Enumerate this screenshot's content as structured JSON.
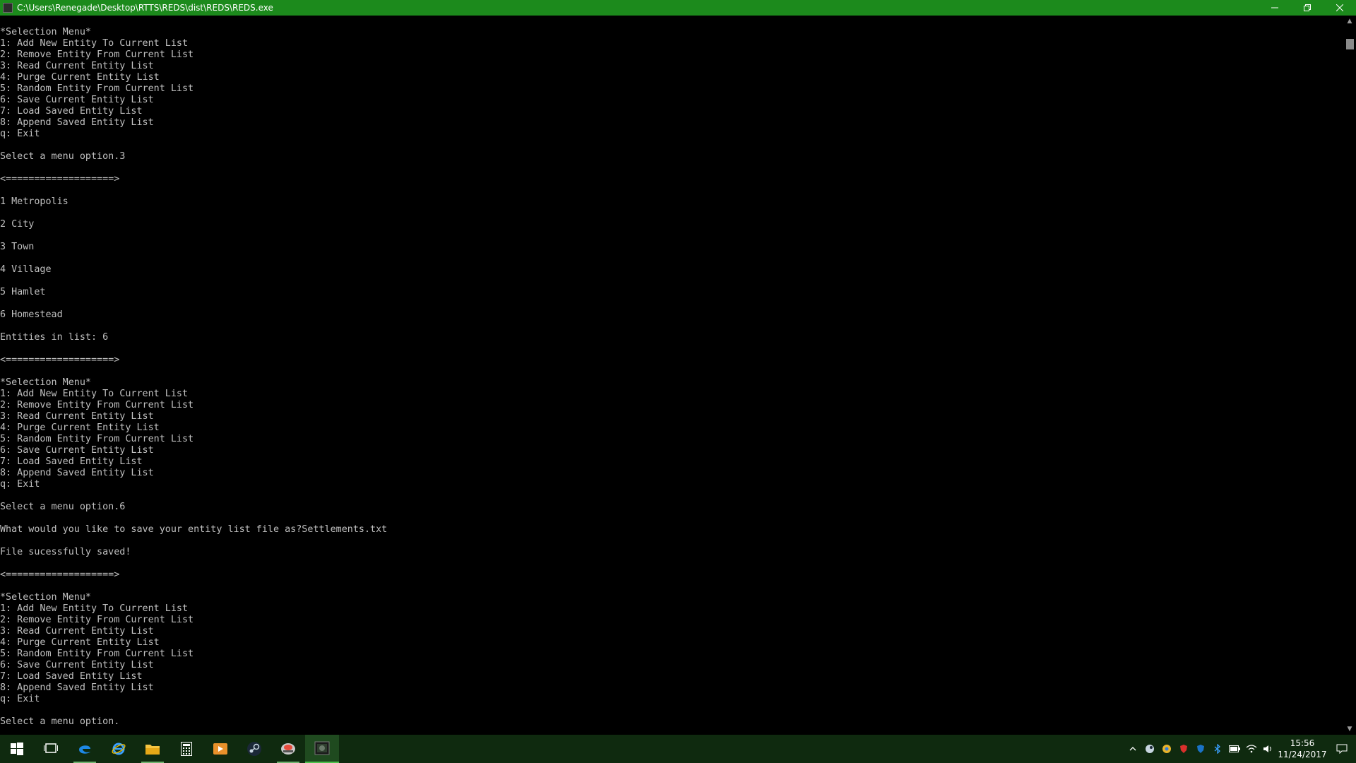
{
  "window": {
    "title": "C:\\Users\\Renegade\\Desktop\\RTTS\\REDS\\dist\\REDS\\REDS.exe",
    "controls": {
      "minimize": "—",
      "restore": "❐",
      "close": "✕"
    }
  },
  "console": {
    "lines": [
      "*Selection Menu*",
      "1: Add New Entity To Current List",
      "2: Remove Entity From Current List",
      "3: Read Current Entity List",
      "4: Purge Current Entity List",
      "5: Random Entity From Current List",
      "6: Save Current Entity List",
      "7: Load Saved Entity List",
      "8: Append Saved Entity List",
      "q: Exit",
      "",
      "Select a menu option.3",
      "",
      "<===================>",
      "",
      "1 Metropolis",
      "",
      "2 City",
      "",
      "3 Town",
      "",
      "4 Village",
      "",
      "5 Hamlet",
      "",
      "6 Homestead",
      "",
      "Entities in list: 6",
      "",
      "<===================>",
      "",
      "*Selection Menu*",
      "1: Add New Entity To Current List",
      "2: Remove Entity From Current List",
      "3: Read Current Entity List",
      "4: Purge Current Entity List",
      "5: Random Entity From Current List",
      "6: Save Current Entity List",
      "7: Load Saved Entity List",
      "8: Append Saved Entity List",
      "q: Exit",
      "",
      "Select a menu option.6",
      "",
      "What would you like to save your entity list file as?Settlements.txt",
      "",
      "File sucessfully saved!",
      "",
      "<===================>",
      "",
      "*Selection Menu*",
      "1: Add New Entity To Current List",
      "2: Remove Entity From Current List",
      "3: Read Current Entity List",
      "4: Purge Current Entity List",
      "5: Random Entity From Current List",
      "6: Save Current Entity List",
      "7: Load Saved Entity List",
      "8: Append Saved Entity List",
      "q: Exit",
      "",
      "Select a menu option."
    ]
  },
  "taskbar": {
    "apps": [
      {
        "name": "start-icon",
        "active": false
      },
      {
        "name": "task-view-icon",
        "active": false
      },
      {
        "name": "edge-icon",
        "active": false
      },
      {
        "name": "internet-explorer-icon",
        "active": false
      },
      {
        "name": "file-explorer-icon",
        "active": false
      },
      {
        "name": "calculator-icon",
        "active": false
      },
      {
        "name": "media-player-icon",
        "active": false
      },
      {
        "name": "steam-icon",
        "active": false
      },
      {
        "name": "game-app-icon",
        "active": false
      },
      {
        "name": "reds-console-icon",
        "active": true
      }
    ],
    "tray": {
      "time": "15:56",
      "date": "11/24/2017"
    }
  },
  "colors": {
    "titlebar": "#1c8a1c",
    "taskbar": "#0f2a0f",
    "console_bg": "#000000",
    "console_text": "#c0c0c0"
  }
}
